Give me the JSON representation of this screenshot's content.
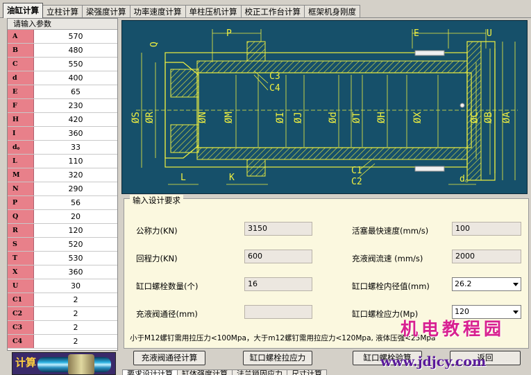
{
  "tabs": [
    "油缸计算",
    "立柱计算",
    "梁强度计算",
    "功率速度计算",
    "单柱压机计算",
    "校正工作台计算",
    "框架机身刚度"
  ],
  "left_panel": {
    "title": "请输入参数",
    "params": [
      {
        "label": "A",
        "value": "570"
      },
      {
        "label": "B",
        "value": "480"
      },
      {
        "label": "C",
        "value": "550"
      },
      {
        "label": "d",
        "value": "400"
      },
      {
        "label": "E",
        "value": "65"
      },
      {
        "label": "F",
        "value": "230"
      },
      {
        "label": "H",
        "value": "420"
      },
      {
        "label": "I",
        "value": "360"
      },
      {
        "label": "d。",
        "value": "33"
      },
      {
        "label": "L",
        "value": "110"
      },
      {
        "label": "M",
        "value": "320"
      },
      {
        "label": "N",
        "value": "290"
      },
      {
        "label": "P",
        "value": "56"
      },
      {
        "label": "Q",
        "value": "20"
      },
      {
        "label": "R",
        "value": "120"
      },
      {
        "label": "S",
        "value": "520"
      },
      {
        "label": "T",
        "value": "530"
      },
      {
        "label": "X",
        "value": "360"
      },
      {
        "label": "U",
        "value": "30"
      },
      {
        "label": "C1",
        "value": "2"
      },
      {
        "label": "C2",
        "value": "2"
      },
      {
        "label": "C3",
        "value": "2"
      },
      {
        "label": "C4",
        "value": "2"
      }
    ],
    "calc_label": "计算"
  },
  "drawing": {
    "labels_top": [
      "P",
      "Q",
      "E",
      "U"
    ],
    "labels_c": [
      "C3",
      "C4",
      "C1",
      "C2"
    ],
    "labels_bottom": [
      "L",
      "K",
      "d。"
    ],
    "diameters": [
      "ØS",
      "ØR",
      "ØN",
      "ØM",
      "ØI",
      "ØJ",
      "Ød",
      "ØT",
      "ØH",
      "ØX",
      "ØC",
      "ØB",
      "ØA"
    ]
  },
  "form": {
    "legend": "输入设计要求",
    "nominal_force_label": "公称力(KN)",
    "nominal_force_value": "3150",
    "piston_speed_label": "活塞最快速度(mm/s)",
    "piston_speed_value": "100",
    "return_force_label": "回程力(KN)",
    "return_force_value": "600",
    "fill_flow_label": "充液阀流速  (mm/s)",
    "fill_flow_value": "2000",
    "bolt_count_label": "缸口螺栓数量(个)",
    "bolt_count_value": "16",
    "bolt_inner_dia_label": "缸口螺栓内径值(mm)",
    "bolt_inner_dia_value": "26.2",
    "fill_valve_dia_label": "充液阀通径(mm)",
    "fill_valve_dia_value": "",
    "bolt_stress_label": "缸口螺栓应力(Mp)",
    "bolt_stress_value": "120",
    "note": "小于M12螺钉需用拉压力<100Mpa，大于m12螺钉需用拉应力<120Mpa, 液体压强<25Mpa",
    "btn_fill_valve": "充液阀通径计算",
    "btn_bolt_stress": "缸口螺栓拉应力",
    "btn_bolt_check": "缸口螺栓验算",
    "btn_return": "返回"
  },
  "bottom_tabs": [
    "要求设计计算",
    "缸体强度计算",
    "法兰锁固应力",
    "尺寸计算"
  ],
  "watermark": {
    "title": "机电教程园",
    "url": "www.jdjcy.com"
  }
}
